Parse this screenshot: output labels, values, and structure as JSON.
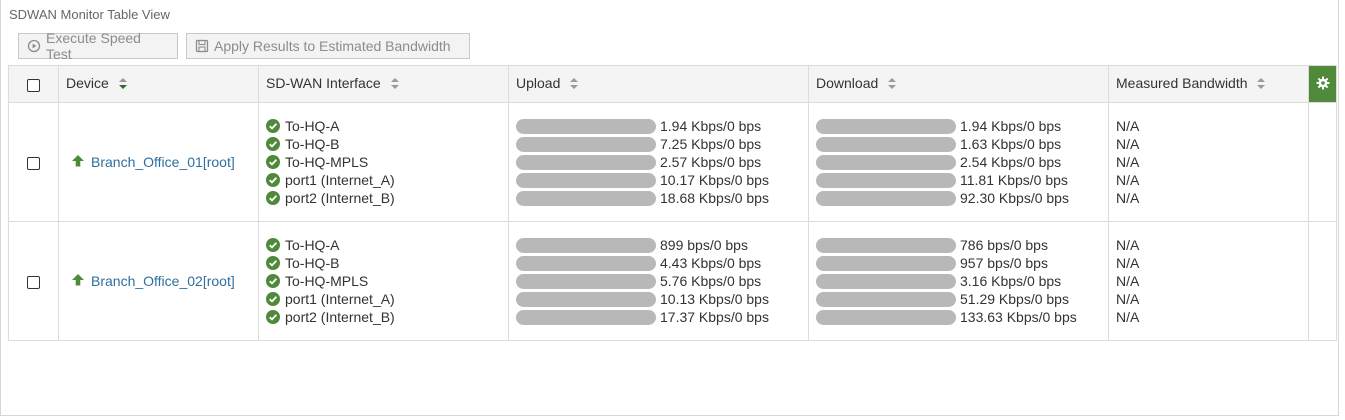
{
  "panel": {
    "title": "SDWAN Monitor Table View"
  },
  "toolbar": {
    "speed_test_label": "Execute Speed Test",
    "apply_label": "Apply Results to Estimated Bandwidth"
  },
  "columns": {
    "device": "Device",
    "interface": "SD-WAN Interface",
    "upload": "Upload",
    "download": "Download",
    "measured": "Measured Bandwidth"
  },
  "rows": [
    {
      "device": "Branch_Office_01[root]",
      "interfaces": [
        "To-HQ-A",
        "To-HQ-B",
        "To-HQ-MPLS",
        "port1 (Internet_A)",
        "port2 (Internet_B)"
      ],
      "upload": [
        "1.94 Kbps/0 bps",
        "7.25 Kbps/0 bps",
        "2.57 Kbps/0 bps",
        "10.17 Kbps/0 bps",
        "18.68 Kbps/0 bps"
      ],
      "download": [
        "1.94 Kbps/0 bps",
        "1.63 Kbps/0 bps",
        "2.54 Kbps/0 bps",
        "11.81 Kbps/0 bps",
        "92.30 Kbps/0 bps"
      ],
      "measured": [
        "N/A",
        "N/A",
        "N/A",
        "N/A",
        "N/A"
      ]
    },
    {
      "device": "Branch_Office_02[root]",
      "interfaces": [
        "To-HQ-A",
        "To-HQ-B",
        "To-HQ-MPLS",
        "port1 (Internet_A)",
        "port2 (Internet_B)"
      ],
      "upload": [
        "899 bps/0 bps",
        "4.43 Kbps/0 bps",
        "5.76 Kbps/0 bps",
        "10.13 Kbps/0 bps",
        "17.37 Kbps/0 bps"
      ],
      "download": [
        "786 bps/0 bps",
        "957 bps/0 bps",
        "3.16 Kbps/0 bps",
        "51.29 Kbps/0 bps",
        "133.63 Kbps/0 bps"
      ],
      "measured": [
        "N/A",
        "N/A",
        "N/A",
        "N/A",
        "N/A"
      ]
    }
  ],
  "icons": {
    "status": "check-circle-icon",
    "device_up": "arrow-up-icon",
    "settings": "gear-icon"
  },
  "colors": {
    "status_ok": "#4f8a3b",
    "link": "#2f6f9f",
    "bar_track": "#b8b8b8",
    "gear_bg": "#4f8a3b"
  }
}
